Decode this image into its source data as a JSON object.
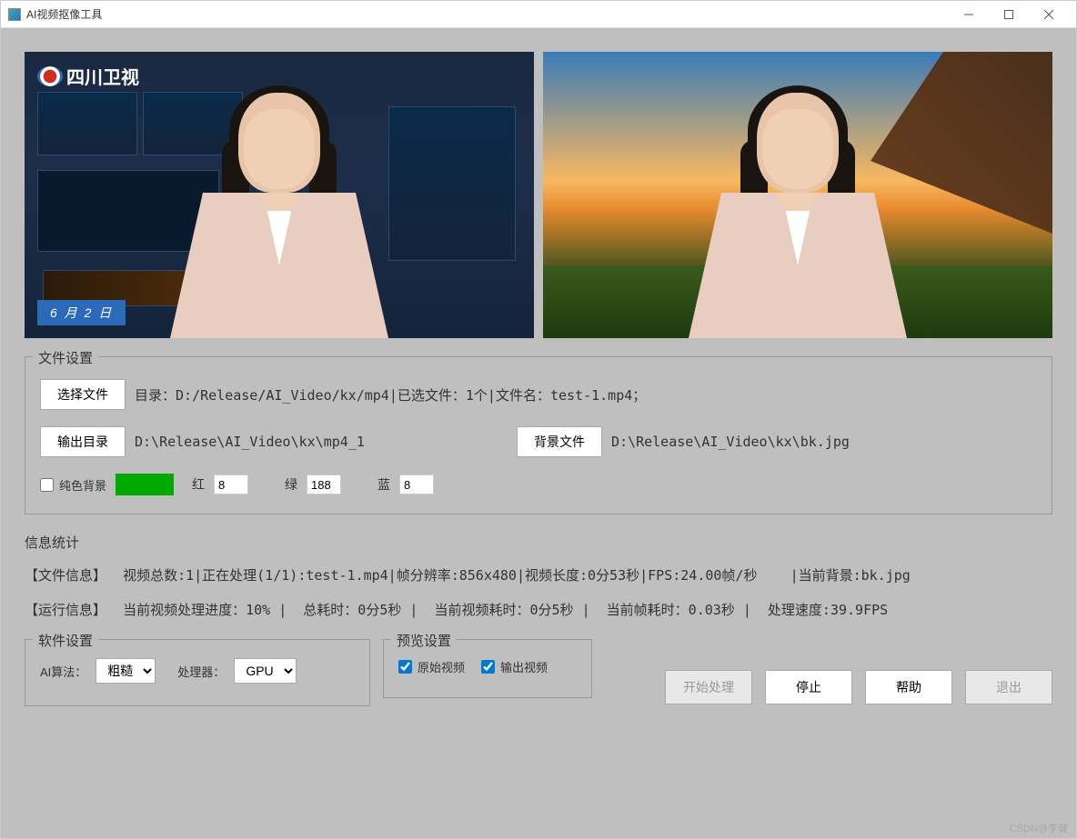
{
  "window": {
    "title": "AI视频抠像工具"
  },
  "sc_logo": "四川卫视",
  "date_bar": "6 月 2 日",
  "file_settings": {
    "title": "文件设置",
    "select_file_btn": "选择文件",
    "dir_label": "目录：",
    "dir_value": "D:/Release/AI_Video/kx/mp4",
    "selected_label": "已选文件：",
    "selected_value": "1个",
    "filename_label": "文件名：",
    "filename_value": "test-1.mp4；",
    "output_dir_btn": "输出目录",
    "output_dir_value": "D:\\Release\\AI_Video\\kx\\mp4_1",
    "bg_file_btn": "背景文件",
    "bg_file_value": "D:\\Release\\AI_Video\\kx\\bk.jpg",
    "solid_bg_label": "纯色背景",
    "r_label": "红",
    "r_value": "8",
    "g_label": "绿",
    "g_value": "188",
    "b_label": "蓝",
    "b_value": "8"
  },
  "stats": {
    "title": "信息统计",
    "file_info_label": "【文件信息】",
    "video_total": "视频总数:1",
    "processing": "正在处理(1/1):test-1.mp4",
    "resolution": "帧分辨率:856x480",
    "duration": "视频长度:0分53秒",
    "fps": "FPS:24.00帧/秒",
    "current_bg": "当前背景:bk.jpg",
    "run_info_label": "【运行信息】",
    "progress": "当前视频处理进度：10%",
    "total_time": "总耗时：0分5秒",
    "cur_video_time": "当前视频耗时：0分5秒",
    "cur_frame_time": "当前帧耗时：0.03秒",
    "speed": "处理速度:39.9FPS"
  },
  "soft_settings": {
    "title": "软件设置",
    "algo_label": "AI算法：",
    "algo_value": "粗糙",
    "proc_label": "处理器：",
    "proc_value": "GPU"
  },
  "preview_settings": {
    "title": "预览设置",
    "orig_label": "原始视频",
    "out_label": "输出视频"
  },
  "actions": {
    "start": "开始处理",
    "stop": "停止",
    "help": "帮助",
    "exit": "退出"
  },
  "watermark": "CSDN@李健"
}
